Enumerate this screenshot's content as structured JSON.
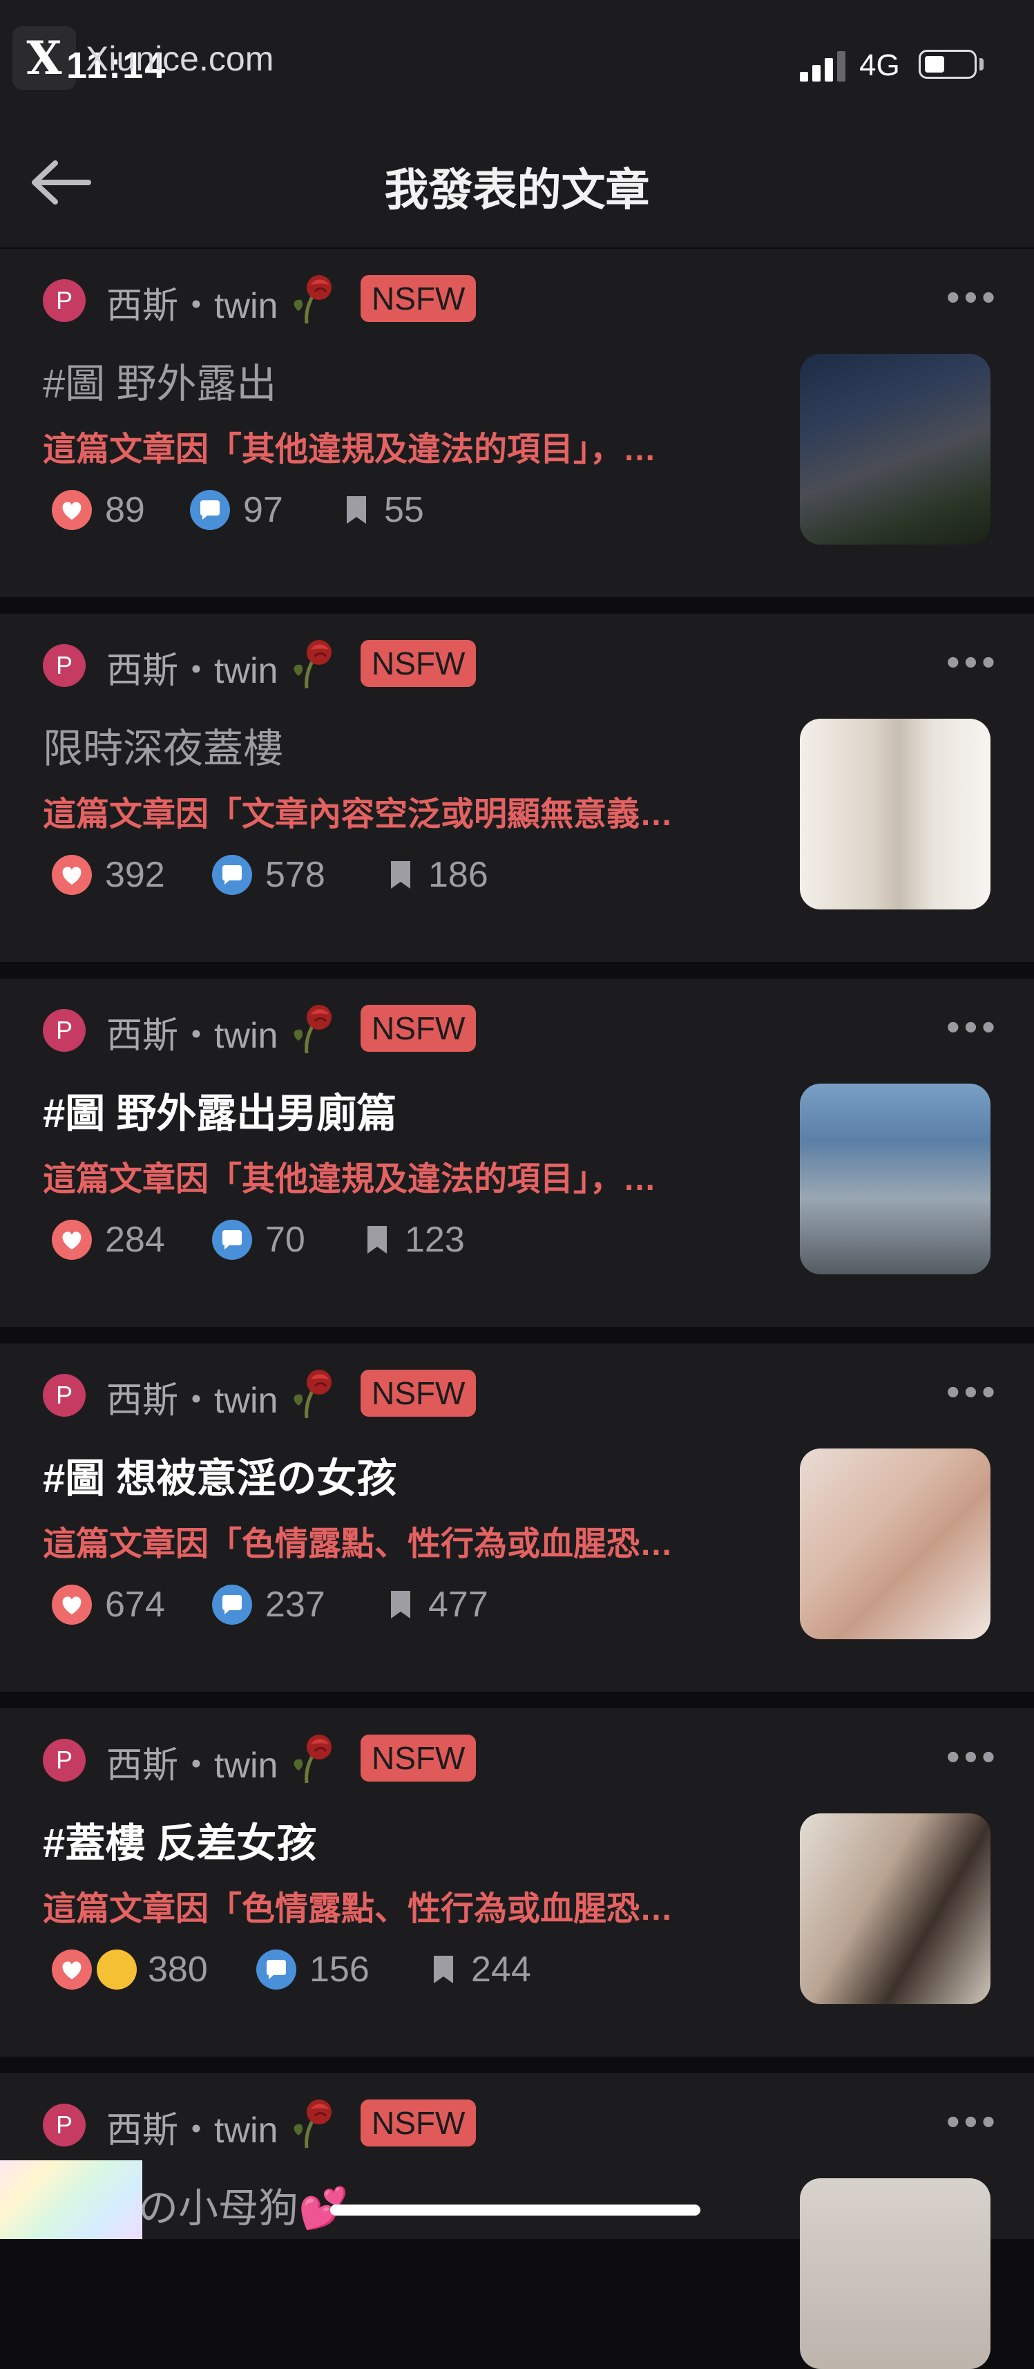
{
  "watermark": {
    "logo": "X",
    "text": "Xiunice.com"
  },
  "status_bar": {
    "time": "11:14",
    "carrier": "4G"
  },
  "header": {
    "title": "我發表的文章"
  },
  "posts": [
    {
      "avatar": "P",
      "author": "西斯・twin",
      "badge": "NSFW",
      "title": "#圖 野外露出",
      "title_bold": false,
      "reason": "這篇文章因「其他違規及違法的項目」，…",
      "likes": "89",
      "comments": "97",
      "saves": "55",
      "thumb": "night building outdoor photo"
    },
    {
      "avatar": "P",
      "author": "西斯・twin",
      "badge": "NSFW",
      "title": "限時深夜蓋樓",
      "title_bold": false,
      "reason": "這篇文章因「文章內容空泛或明顯無意義…",
      "likes": "392",
      "comments": "578",
      "saves": "186",
      "thumb": "mirror selfie photo"
    },
    {
      "avatar": "P",
      "author": "西斯・twin",
      "badge": "NSFW",
      "title": "#圖 野外露出男廁篇",
      "title_bold": true,
      "reason": "這篇文章因「其他違規及違法的項目」，…",
      "likes": "284",
      "comments": "70",
      "saves": "123",
      "thumb": "restroom photo"
    },
    {
      "avatar": "P",
      "author": "西斯・twin",
      "badge": "NSFW",
      "title": "#圖 想被意淫の女孩",
      "title_bold": true,
      "reason": "這篇文章因「色情露點、性行為或血腥恐…",
      "likes": "674",
      "comments": "237",
      "saves": "477",
      "thumb": "portrait photo"
    },
    {
      "avatar": "P",
      "author": "西斯・twin",
      "badge": "NSFW",
      "title": "#蓋樓 反差女孩",
      "title_bold": true,
      "reason": "這篇文章因「色情露點、性行為或血腥恐…",
      "likes": "380",
      "comments": "156",
      "saves": "244",
      "thumb": "room photo"
    },
    {
      "avatar": "P",
      "author": "西斯・twin",
      "badge": "NSFW",
      "title": "の小母狗💕",
      "title_bold": false,
      "reason": "",
      "likes": "",
      "comments": "",
      "saves": "",
      "thumb": "partial photo"
    }
  ],
  "colors": {
    "accent_red": "#e05a5a",
    "avatar": "#c53b62",
    "like": "#ef6b6b",
    "comment": "#4a90d9",
    "background": "#1c1c1e"
  },
  "icons": {
    "back": "arrow-left-icon",
    "more": "more-dots-icon",
    "like": "heart-icon",
    "comment": "comment-icon",
    "save": "bookmark-icon"
  }
}
